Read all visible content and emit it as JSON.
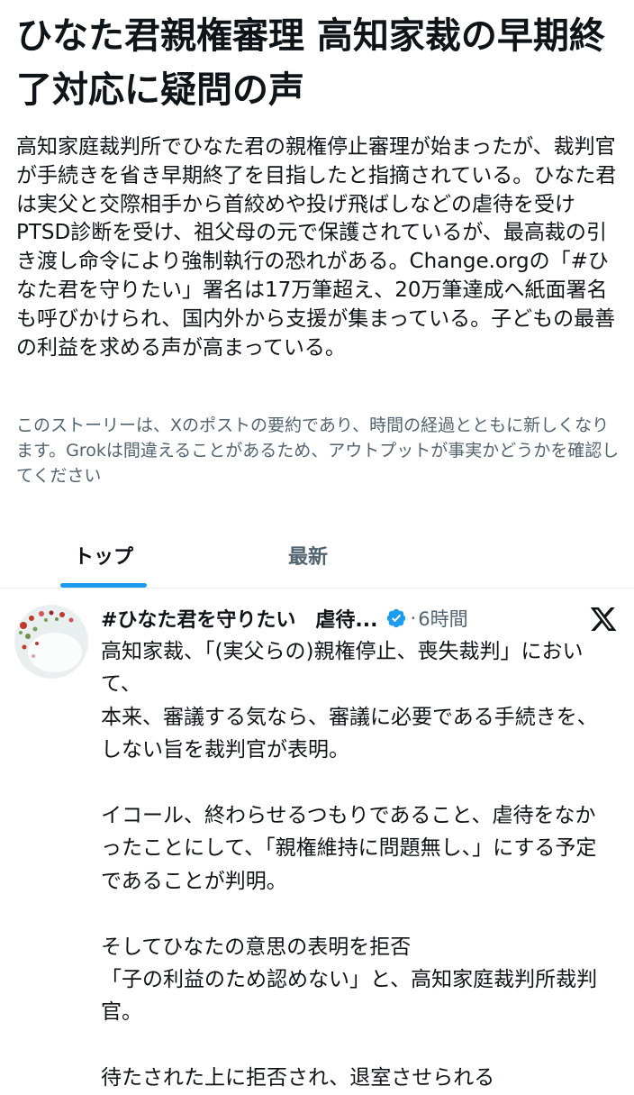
{
  "story": {
    "headline": "ひなた君親権審理 高知家裁の早期終了対応に疑問の声",
    "summary": "高知家庭裁判所でひなた君の親権停止審理が始まったが、裁判官が手続きを省き早期終了を目指したと指摘されている。ひなた君は実父と交際相手から首絞めや投げ飛ばしなどの虐待を受けPTSD診断を受け、祖父母の元で保護されているが、最高裁の引き渡し命令により強制執行の恐れがある。Change.orgの「#ひなた君を守りたい」署名は17万筆超え、20万筆達成へ紙面署名も呼びかけられ、国内外から支援が集まっている。子どもの最善の利益を求める声が高まっている。",
    "disclaimer": "このストーリーは、Xのポストの要約であり、時間の経過とともに新しくなります。Grokは間違えることがあるため、アウトプットが事実かどうかを確認してください"
  },
  "tabs": [
    {
      "label": "トップ",
      "active": true
    },
    {
      "label": "最新",
      "active": false
    }
  ],
  "post": {
    "author_name": "#ひなた君を守りたい　虐待...",
    "verified": true,
    "separator": "·",
    "time": "6時間",
    "body": "高知家裁、「(実父らの)親権停止、喪失裁判」において、\n本来、審議する気なら、審議に必要である手続きを、しない旨を裁判官が表明。\n\nイコール、終わらせるつもりであること、虐待をなかったことにして、「親権維持に問題無し、」にする予定であることが判明。\n\nそしてひなたの意思の表明を拒否\n「子の利益のため認めない」と、高知家庭裁判所裁判官。\n\n待たされた上に拒否され、退室させられる"
  },
  "icons": {
    "verified": "verified-badge-icon",
    "platform": "x-logo-icon"
  },
  "colors": {
    "accent": "#1d9bf0",
    "text_primary": "#0f1419",
    "text_secondary": "#536471",
    "divider": "#e6ecf0"
  }
}
